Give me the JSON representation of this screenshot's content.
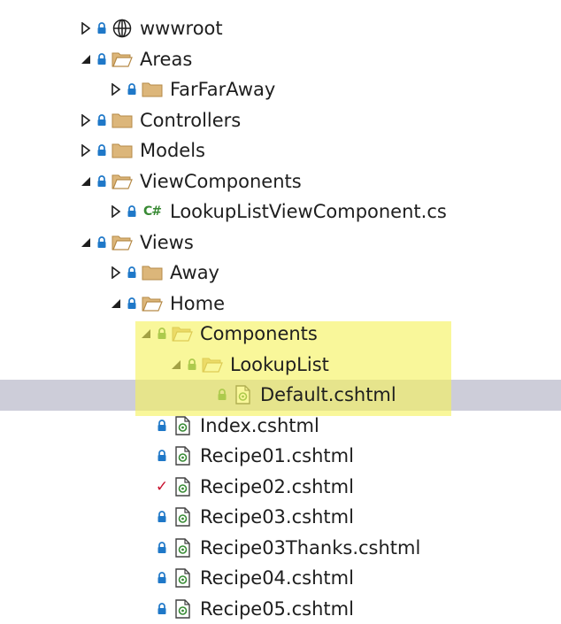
{
  "tree": {
    "items": [
      {
        "label": "wwwroot",
        "depth": 0,
        "expander": "collapsed",
        "status": "lock",
        "icon": "globe"
      },
      {
        "label": "Areas",
        "depth": 0,
        "expander": "expanded",
        "status": "lock",
        "icon": "folder-open"
      },
      {
        "label": "FarFarAway",
        "depth": 1,
        "expander": "collapsed",
        "status": "lock",
        "icon": "folder"
      },
      {
        "label": "Controllers",
        "depth": 0,
        "expander": "collapsed",
        "status": "lock",
        "icon": "folder"
      },
      {
        "label": "Models",
        "depth": 0,
        "expander": "collapsed",
        "status": "lock",
        "icon": "folder"
      },
      {
        "label": "ViewComponents",
        "depth": 0,
        "expander": "expanded",
        "status": "lock",
        "icon": "folder-open"
      },
      {
        "label": "LookupListViewComponent.cs",
        "depth": 1,
        "expander": "collapsed",
        "status": "lock",
        "icon": "csharp",
        "icon_text": "C#"
      },
      {
        "label": "Views",
        "depth": 0,
        "expander": "expanded",
        "status": "lock",
        "icon": "folder-open"
      },
      {
        "label": "Away",
        "depth": 1,
        "expander": "collapsed",
        "status": "lock",
        "icon": "folder"
      },
      {
        "label": "Home",
        "depth": 1,
        "expander": "expanded",
        "status": "lock",
        "icon": "folder-open"
      },
      {
        "label": "Components",
        "depth": 2,
        "expander": "expanded",
        "status": "add",
        "icon": "folder-open"
      },
      {
        "label": "LookupList",
        "depth": 3,
        "expander": "expanded",
        "status": "add",
        "icon": "folder-open"
      },
      {
        "label": "Default.cshtml",
        "depth": 4,
        "expander": "none",
        "status": "add",
        "icon": "razor",
        "selected": true
      },
      {
        "label": "Index.cshtml",
        "depth": 2,
        "expander": "none",
        "status": "lock",
        "icon": "razor"
      },
      {
        "label": "Recipe01.cshtml",
        "depth": 2,
        "expander": "none",
        "status": "lock",
        "icon": "razor"
      },
      {
        "label": "Recipe02.cshtml",
        "depth": 2,
        "expander": "none",
        "status": "check",
        "icon": "razor"
      },
      {
        "label": "Recipe03.cshtml",
        "depth": 2,
        "expander": "none",
        "status": "lock",
        "icon": "razor"
      },
      {
        "label": "Recipe03Thanks.cshtml",
        "depth": 2,
        "expander": "none",
        "status": "lock",
        "icon": "razor"
      },
      {
        "label": "Recipe04.cshtml",
        "depth": 2,
        "expander": "none",
        "status": "lock",
        "icon": "razor"
      },
      {
        "label": "Recipe05.cshtml",
        "depth": 2,
        "expander": "none",
        "status": "lock",
        "icon": "razor"
      }
    ]
  },
  "colors": {
    "text": "#1e1e1e",
    "folder": "#dcb67a",
    "folder_dark": "#b68b48",
    "lock": "#1f78c8",
    "add_lock": "#388a34",
    "check": "#c8102e",
    "selection": "#cdcdd9",
    "highlight": "#f6f25c",
    "csharp": "#388a34",
    "razor": "#388a34"
  }
}
